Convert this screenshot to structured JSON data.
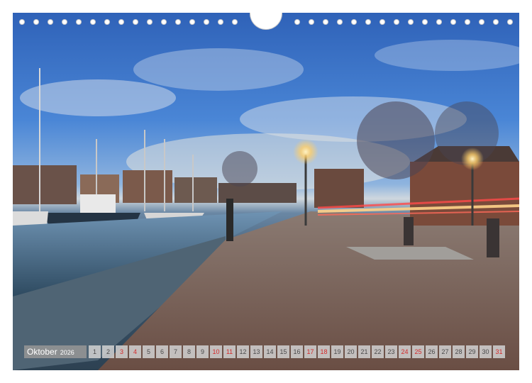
{
  "calendar": {
    "month": "Oktober",
    "year": "2026",
    "days": [
      {
        "n": "1",
        "sun": false
      },
      {
        "n": "2",
        "sun": false
      },
      {
        "n": "3",
        "sun": true
      },
      {
        "n": "4",
        "sun": true
      },
      {
        "n": "5",
        "sun": false
      },
      {
        "n": "6",
        "sun": false
      },
      {
        "n": "7",
        "sun": false
      },
      {
        "n": "8",
        "sun": false
      },
      {
        "n": "9",
        "sun": false
      },
      {
        "n": "10",
        "sun": true
      },
      {
        "n": "11",
        "sun": true
      },
      {
        "n": "12",
        "sun": false
      },
      {
        "n": "13",
        "sun": false
      },
      {
        "n": "14",
        "sun": false
      },
      {
        "n": "15",
        "sun": false
      },
      {
        "n": "16",
        "sun": false
      },
      {
        "n": "17",
        "sun": true
      },
      {
        "n": "18",
        "sun": true
      },
      {
        "n": "19",
        "sun": false
      },
      {
        "n": "20",
        "sun": false
      },
      {
        "n": "21",
        "sun": false
      },
      {
        "n": "22",
        "sun": false
      },
      {
        "n": "23",
        "sun": false
      },
      {
        "n": "24",
        "sun": true
      },
      {
        "n": "25",
        "sun": true
      },
      {
        "n": "26",
        "sun": false
      },
      {
        "n": "27",
        "sun": false
      },
      {
        "n": "28",
        "sun": false
      },
      {
        "n": "29",
        "sun": false
      },
      {
        "n": "30",
        "sun": false
      },
      {
        "n": "31",
        "sun": true
      }
    ]
  },
  "colors": {
    "weekend": "#d42a2a",
    "sky": "#3a72c8",
    "lamp_glow": "#ffcf6a"
  }
}
